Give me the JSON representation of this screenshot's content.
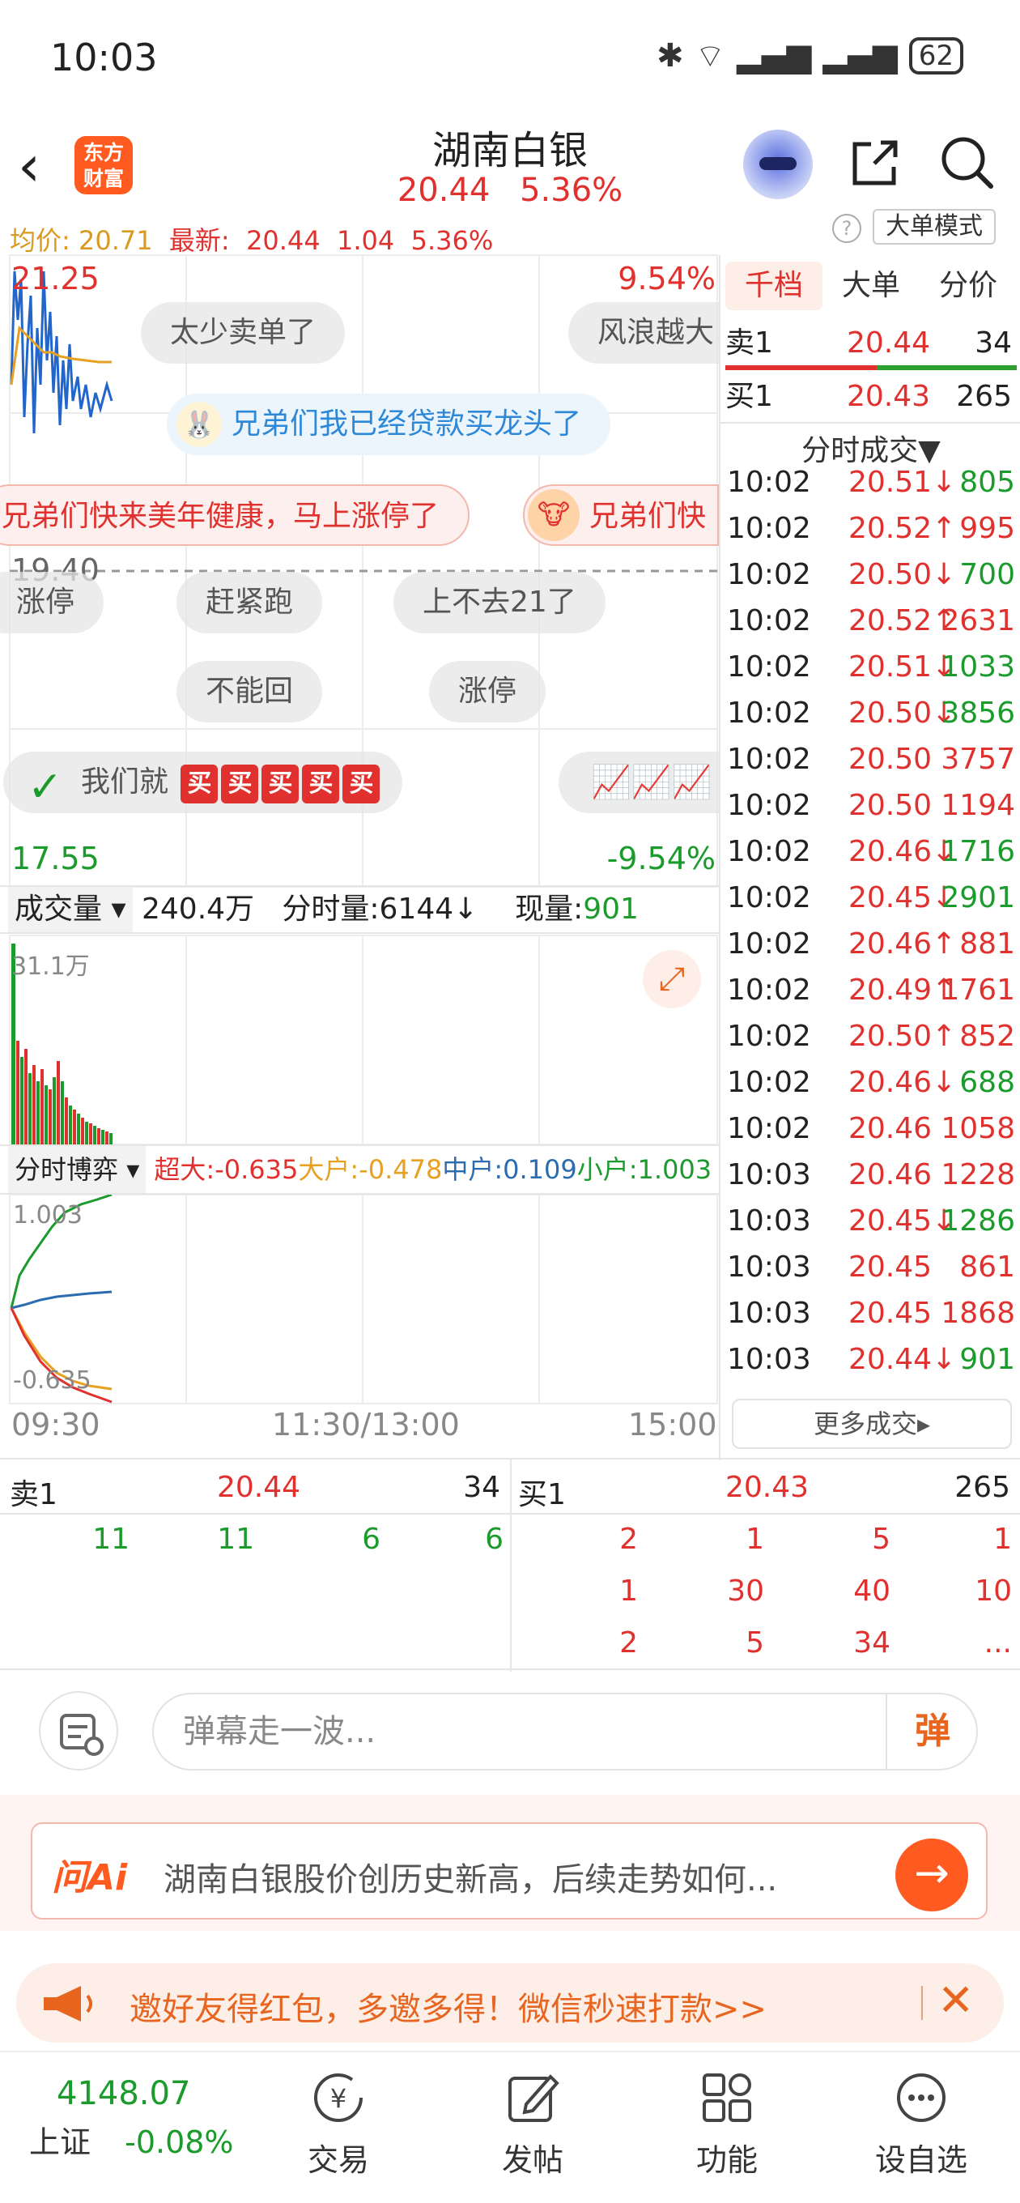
{
  "status_bar": {
    "time": "10:03",
    "battery": "62"
  },
  "header": {
    "logo_text": "东方财富",
    "title": "湖南白银",
    "price": "20.44",
    "change_pct": "5.36%"
  },
  "info_line": {
    "avg_label": "均价:",
    "avg_value": "20.71",
    "latest_label": "最新:",
    "latest_value": "20.44",
    "change": "1.04",
    "change_pct": "5.36%",
    "mode_button": "大单模式"
  },
  "chart_labels": {
    "price_high": "21.25",
    "pct_high": "9.54%",
    "price_prev_close": "19.40",
    "price_low": "17.55",
    "pct_low": "-9.54%",
    "volume_max": "31.1万",
    "flow_top": "1.003",
    "flow_bottom": "-0.635",
    "time_start": "09:30",
    "time_mid": "11:30/13:00",
    "time_end": "15:00"
  },
  "danmu": [
    "太少卖单了",
    "风浪越大",
    "兄弟们我已经贷款买龙头了",
    "兄弟们快来美年健康，马上涨停了",
    "兄弟们快",
    "涨停",
    "赶紧跑",
    "上不去21了",
    "不能回",
    "涨停",
    "我们就"
  ],
  "danmu_buy_chip": "买",
  "volume_header": {
    "selector": "成交量",
    "total": "240.4万",
    "tick_label": "分时量:",
    "tick_value": "6144↓",
    "current_label": "现量:",
    "current_value": "901"
  },
  "flow_header": {
    "selector": "分时博弈",
    "super_label": "超大:",
    "super_value": "-0.635",
    "large_label": "大户:",
    "large_value": "-0.478",
    "mid_label": "中户:",
    "mid_value": "0.109",
    "small_label": "小户:",
    "small_value": "1.003"
  },
  "right_panel": {
    "tabs": [
      "千档",
      "大单",
      "分价"
    ],
    "ask1": {
      "label": "卖1",
      "price": "20.44",
      "qty": "34"
    },
    "bid1": {
      "label": "买1",
      "price": "20.43",
      "qty": "265"
    },
    "trades_title": "分时成交▼",
    "trades": [
      {
        "time": "10:02",
        "price": "20.51↓",
        "vol": "805",
        "dir": "down"
      },
      {
        "time": "10:02",
        "price": "20.52↑",
        "vol": "995",
        "dir": "up"
      },
      {
        "time": "10:02",
        "price": "20.50↓",
        "vol": "700",
        "dir": "down"
      },
      {
        "time": "10:02",
        "price": "20.52↑",
        "vol": "2631",
        "dir": "up"
      },
      {
        "time": "10:02",
        "price": "20.51↓",
        "vol": "1033",
        "dir": "down"
      },
      {
        "time": "10:02",
        "price": "20.50↓",
        "vol": "3856",
        "dir": "down"
      },
      {
        "time": "10:02",
        "price": "20.50",
        "vol": "3757",
        "dir": "up"
      },
      {
        "time": "10:02",
        "price": "20.50",
        "vol": "1194",
        "dir": "up"
      },
      {
        "time": "10:02",
        "price": "20.46↓",
        "vol": "1716",
        "dir": "down"
      },
      {
        "time": "10:02",
        "price": "20.45↓",
        "vol": "2901",
        "dir": "down"
      },
      {
        "time": "10:02",
        "price": "20.46↑",
        "vol": "881",
        "dir": "up"
      },
      {
        "time": "10:02",
        "price": "20.49↑",
        "vol": "1761",
        "dir": "up"
      },
      {
        "time": "10:02",
        "price": "20.50↑",
        "vol": "852",
        "dir": "up"
      },
      {
        "time": "10:02",
        "price": "20.46↓",
        "vol": "688",
        "dir": "down"
      },
      {
        "time": "10:02",
        "price": "20.46",
        "vol": "1058",
        "dir": "up"
      },
      {
        "time": "10:03",
        "price": "20.46",
        "vol": "1228",
        "dir": "up"
      },
      {
        "time": "10:03",
        "price": "20.45↓",
        "vol": "1286",
        "dir": "down"
      },
      {
        "time": "10:03",
        "price": "20.45",
        "vol": "861",
        "dir": "up"
      },
      {
        "time": "10:03",
        "price": "20.45",
        "vol": "1868",
        "dir": "up"
      },
      {
        "time": "10:03",
        "price": "20.44↓",
        "vol": "901",
        "dir": "down"
      }
    ],
    "more_button": "更多成交▸"
  },
  "depth_book": {
    "ask_label": "卖1",
    "ask_price": "20.44",
    "ask_qty": "34",
    "bid_label": "买1",
    "bid_price": "20.43",
    "bid_qty": "265",
    "ask_orders": [
      "11",
      "11",
      "6",
      "6"
    ],
    "bid_orders_row1": [
      "2",
      "1",
      "5",
      "1"
    ],
    "bid_orders_row2": [
      "1",
      "30",
      "40",
      "10"
    ],
    "bid_orders_row3": [
      "2",
      "5",
      "34",
      "..."
    ]
  },
  "danmu_input": {
    "placeholder": "弹幕走一波...",
    "send_label": "弹"
  },
  "ask_ai": {
    "logo": "问Ai",
    "text": "湖南白银股价创历史新高，后续走势如何...",
    "go": "→"
  },
  "invite_banner": {
    "text": "邀好友得红包，多邀多得！微信秒速打款>>",
    "close": "✕"
  },
  "bottom_nav": {
    "index_value": "4148.07",
    "index_name": "上证",
    "index_change": "-0.08%",
    "items": [
      "交易",
      "发帖",
      "功能",
      "设自选"
    ]
  },
  "colors": {
    "up": "#e0312e",
    "down": "#1a9b2c",
    "accent": "#ff5a1f"
  }
}
